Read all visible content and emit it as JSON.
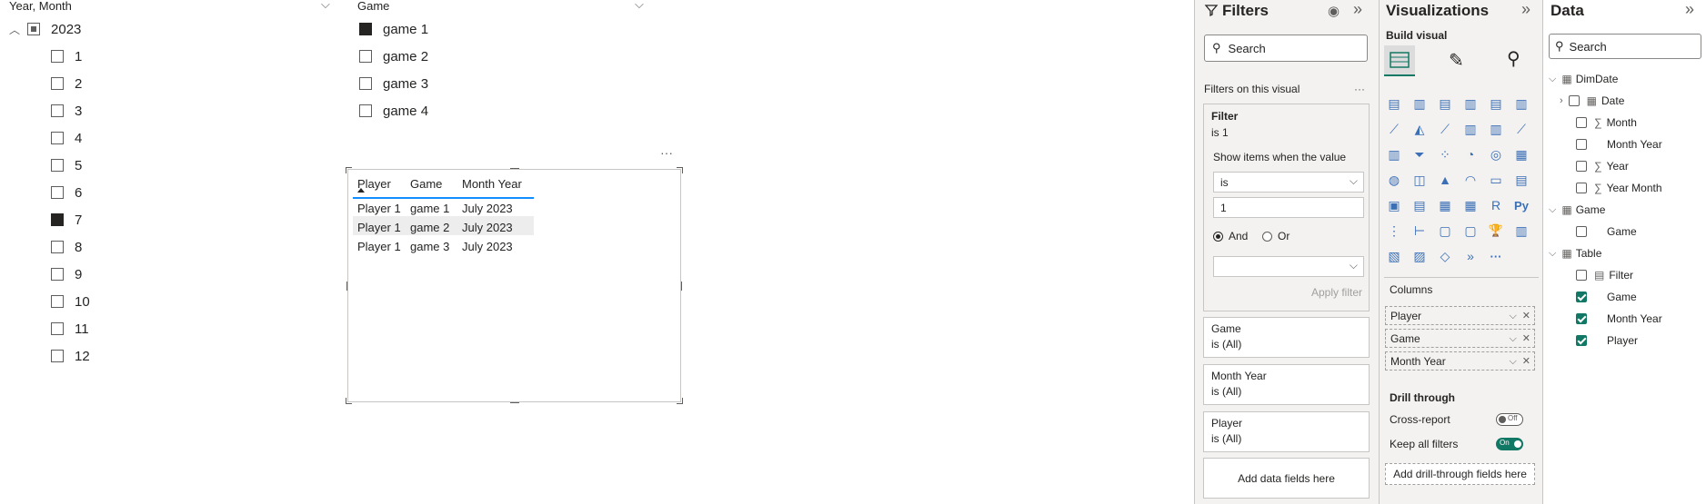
{
  "slicer_year": {
    "header": "Year, Month",
    "year": "2023",
    "months": [
      "1",
      "2",
      "3",
      "4",
      "5",
      "6",
      "7",
      "8",
      "9",
      "10",
      "11",
      "12"
    ],
    "selected_month": "7"
  },
  "slicer_game": {
    "header": "Game",
    "items": [
      "game 1",
      "game 2",
      "game 3",
      "game 4"
    ],
    "selected": "game 1"
  },
  "table_visual": {
    "more_label": "···",
    "columns": [
      "Player",
      "Game",
      "Month Year"
    ],
    "rows": [
      [
        "Player 1",
        "game 1",
        "July 2023"
      ],
      [
        "Player 1",
        "game 2",
        "July 2023"
      ],
      [
        "Player 1",
        "game 3",
        "July 2023"
      ]
    ]
  },
  "filters": {
    "title": "Filters",
    "search_placeholder": "Search",
    "section_label": "Filters on this visual",
    "section_more": "···",
    "active_card": {
      "name": "Filter",
      "summary": "is 1",
      "show_items_label": "Show items when the value",
      "operator": "is",
      "value": "1",
      "and_label": "And",
      "or_label": "Or",
      "apply_label": "Apply filter"
    },
    "cards": [
      {
        "name": "Game",
        "summary": "is (All)"
      },
      {
        "name": "Month Year",
        "summary": "is (All)"
      },
      {
        "name": "Player",
        "summary": "is (All)"
      }
    ],
    "add_fields_label": "Add data fields here"
  },
  "visualizations": {
    "title": "Visualizations",
    "build_label": "Build visual",
    "columns_label": "Columns",
    "column_wells": [
      "Player",
      "Game",
      "Month Year"
    ],
    "drill_title": "Drill through",
    "cross_report_label": "Cross-report",
    "cross_report_state": "Off",
    "keep_filters_label": "Keep all filters",
    "keep_filters_state": "On",
    "add_drill_label": "Add drill-through fields here",
    "icon_r": "R",
    "icon_py": "Py",
    "icon_more": "···"
  },
  "data_pane": {
    "title": "Data",
    "search_placeholder": "Search",
    "tables": [
      {
        "name": "DimDate",
        "fields": [
          "Date",
          "Month",
          "Month Year",
          "Year",
          "Year Month"
        ]
      },
      {
        "name": "Game",
        "fields": [
          "Game"
        ]
      },
      {
        "name": "Table",
        "fields": [
          "Filter",
          "Game",
          "Month Year",
          "Player"
        ]
      }
    ]
  },
  "colors": {
    "accent": "#117865",
    "brand_blue": "#3b6fb6",
    "pane_bg": "#f3f2f1"
  }
}
